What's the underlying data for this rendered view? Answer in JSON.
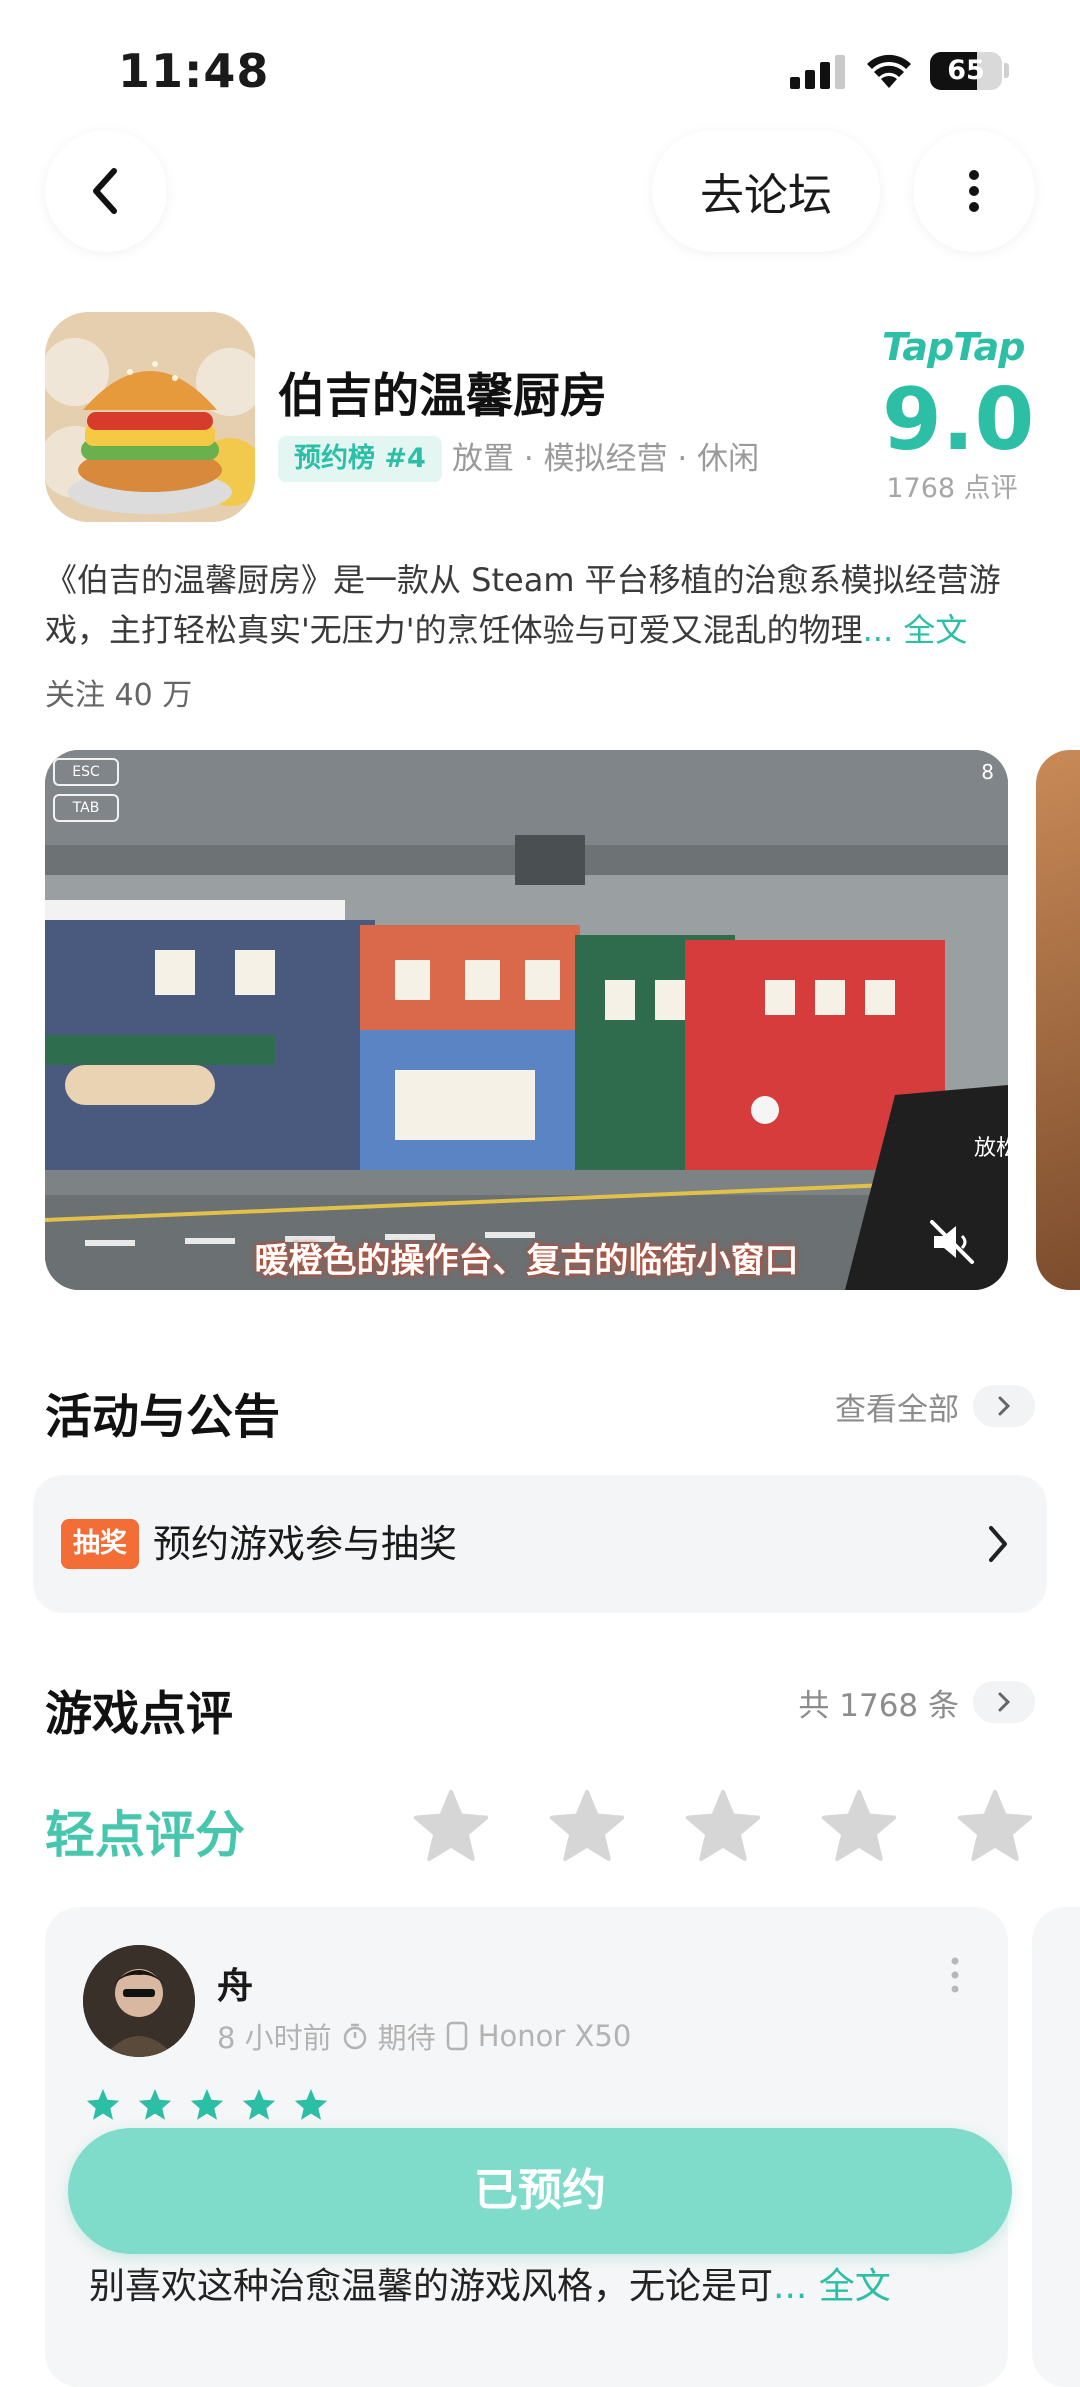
{
  "status_bar": {
    "time": "11:48",
    "battery": "65",
    "battery_level": 0.65
  },
  "header": {
    "forum_label": "去论坛"
  },
  "app": {
    "title": "伯吉的温馨厨房",
    "rank_badge": "预约榜 #4",
    "tags": "放置 · 模拟经营 · 休闲",
    "rating_brand": "TapTap",
    "score": "9.0",
    "review_count": "1768 点评",
    "description": "《伯吉的温馨厨房》是一款从 Steam 平台移植的治愈系模拟经营游戏，主打轻松真实'无压力'的烹饪体验与可爱又混乱的物理",
    "more_label": "... 全文",
    "followers": "关注 40 万"
  },
  "media": {
    "subtitle": "暖橙色的操作台、复古的临街小窗口",
    "hud_esc": "ESC",
    "hud_tab": "TAB",
    "hud_coins": "8",
    "sign_text": "放松"
  },
  "events": {
    "title": "活动与公告",
    "see_all": "查看全部",
    "notice_badge": "抽奖",
    "notice_text": "预约游戏参与抽奖"
  },
  "reviews": {
    "title": "游戏点评",
    "total": "共 1768 条",
    "rate_label": "轻点评分",
    "rate_stars": 5,
    "items": [
      {
        "user": "舟",
        "time": "8 小时前",
        "status": "期待",
        "device": "Honor X50",
        "stars": 5,
        "text": "别喜欢这种治愈温馨的游戏风格，无论是可",
        "more": "... 全文"
      }
    ]
  },
  "cta": {
    "label": "已预约"
  },
  "colors": {
    "accent": "#2dbfa5",
    "cta_bg": "#7fdccb",
    "badge_orange": "#f36d36",
    "star_gray": "#d6d6d6"
  }
}
